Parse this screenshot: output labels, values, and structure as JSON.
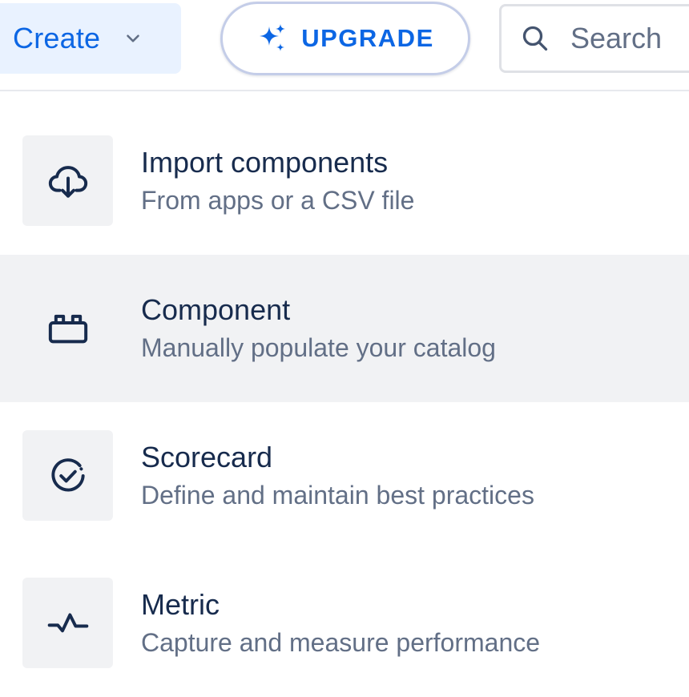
{
  "header": {
    "create_label": "Create",
    "upgrade_label": "UPGRADE",
    "search_placeholder": "Search"
  },
  "menu": {
    "items": [
      {
        "title": "Import components",
        "description": "From apps or a CSV file",
        "icon": "cloud-download-icon"
      },
      {
        "title": "Component",
        "description": "Manually populate your catalog",
        "icon": "component-brick-icon"
      },
      {
        "title": "Scorecard",
        "description": "Define and maintain best practices",
        "icon": "scorecard-check-icon"
      },
      {
        "title": "Metric",
        "description": "Capture and measure performance",
        "icon": "pulse-icon"
      }
    ]
  },
  "colors": {
    "brand": "#0c66e4",
    "text_primary": "#172b4d",
    "text_subtle": "#626f86",
    "hover_bg": "#f1f2f4",
    "create_bg": "#e9f2ff"
  }
}
